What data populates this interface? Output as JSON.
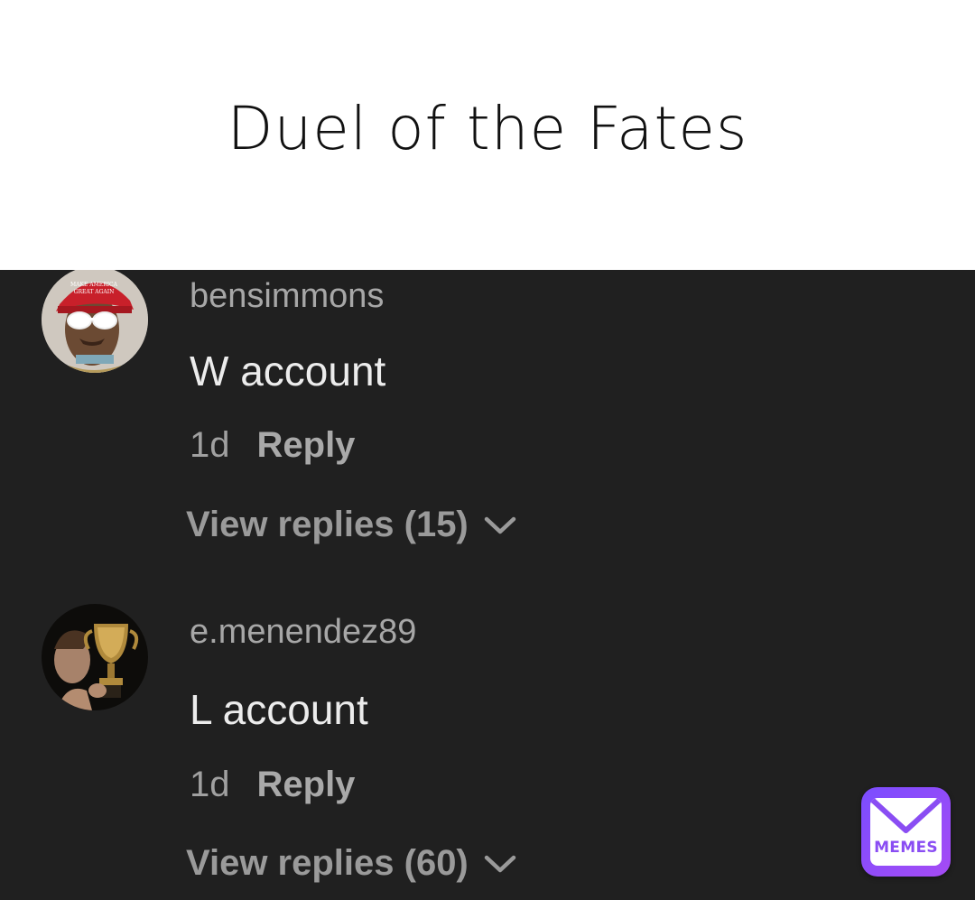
{
  "caption": {
    "text": "Duel of the Fates"
  },
  "comments": [
    {
      "username": "bensimmons",
      "text": "W account",
      "time": "1d",
      "reply_label": "Reply",
      "view_replies": "View replies (15)",
      "avatar_icon": "avatar-red-hat-sunglasses"
    },
    {
      "username": "e.menendez89",
      "text": "L account",
      "time": "1d",
      "reply_label": "Reply",
      "view_replies": "View replies (60)",
      "avatar_icon": "avatar-trophy"
    }
  ],
  "watermark": {
    "label": "MEMES",
    "icon": "envelope-icon"
  },
  "colors": {
    "background": "#202020",
    "username": "#a7a7a7",
    "comment_text": "#ececec",
    "meta": "#a0a0a0",
    "watermark_accent": "#8a4df3"
  }
}
